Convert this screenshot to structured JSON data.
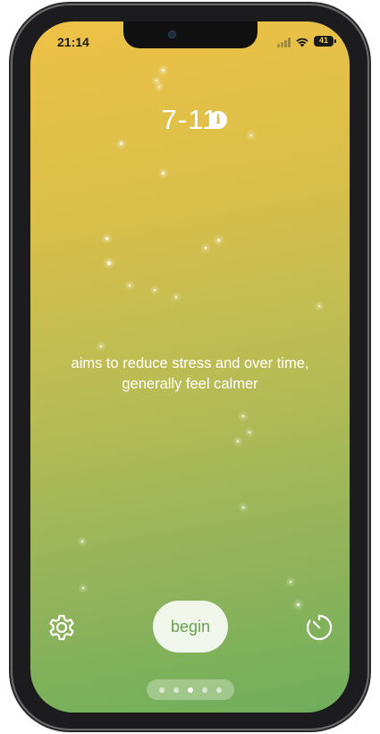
{
  "status": {
    "time": "21:14",
    "battery": "41"
  },
  "screen": {
    "title": "7-11",
    "description_line1": "aims to reduce stress and over time,",
    "description_line2": "generally feel calmer",
    "begin_label": "begin"
  },
  "icons": {
    "info": "info-icon",
    "settings": "gear-icon",
    "timer": "timer-icon"
  },
  "pager": {
    "count": 5,
    "active_index": 2
  },
  "colors": {
    "gradient_top": "#eec146",
    "gradient_bottom": "#6fae5c",
    "begin_text": "#6aa04c"
  }
}
